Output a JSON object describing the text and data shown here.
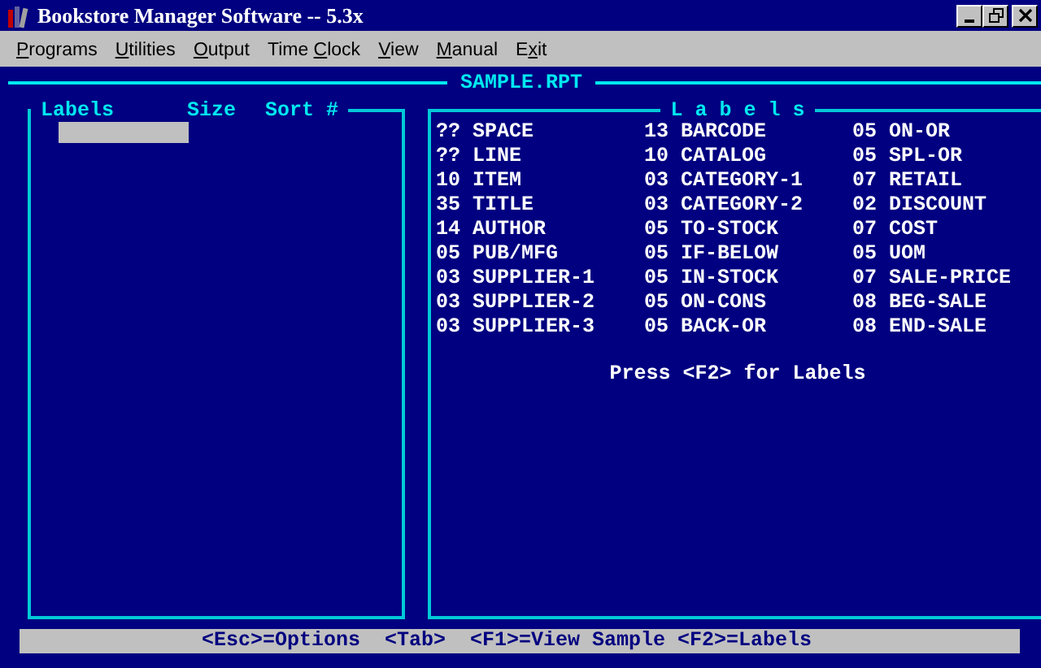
{
  "window": {
    "title": "Bookstore Manager Software -- 5.3x"
  },
  "menu": [
    {
      "key": "P",
      "post": "rograms"
    },
    {
      "key": "U",
      "post": "tilities"
    },
    {
      "key": "O",
      "post": "utput"
    },
    {
      "pre": "Time ",
      "key": "C",
      "post": "lock"
    },
    {
      "key": "V",
      "post": "iew"
    },
    {
      "key": "M",
      "post": "anual"
    },
    {
      "pre": "E",
      "key": "x",
      "post": "it"
    }
  ],
  "report_title": "SAMPLE.RPT",
  "left_panel": {
    "headers": [
      "Labels",
      "Size",
      "Sort #"
    ]
  },
  "right_panel": {
    "title": "L a b e l s",
    "hint": "Press <F2> for Labels",
    "labels": [
      {
        "size": "??",
        "name": "SPACE"
      },
      {
        "size": "??",
        "name": "LINE"
      },
      {
        "size": "10",
        "name": "ITEM"
      },
      {
        "size": "35",
        "name": "TITLE"
      },
      {
        "size": "14",
        "name": "AUTHOR"
      },
      {
        "size": "05",
        "name": "PUB/MFG"
      },
      {
        "size": "03",
        "name": "SUPPLIER-1"
      },
      {
        "size": "03",
        "name": "SUPPLIER-2"
      },
      {
        "size": "03",
        "name": "SUPPLIER-3"
      },
      {
        "size": "13",
        "name": "BARCODE"
      },
      {
        "size": "10",
        "name": "CATALOG"
      },
      {
        "size": "03",
        "name": "CATEGORY-1"
      },
      {
        "size": "03",
        "name": "CATEGORY-2"
      },
      {
        "size": "05",
        "name": "TO-STOCK"
      },
      {
        "size": "05",
        "name": "IF-BELOW"
      },
      {
        "size": "05",
        "name": "IN-STOCK"
      },
      {
        "size": "05",
        "name": "ON-CONS"
      },
      {
        "size": "05",
        "name": "BACK-OR"
      },
      {
        "size": "05",
        "name": "ON-OR"
      },
      {
        "size": "05",
        "name": "SPL-OR"
      },
      {
        "size": "07",
        "name": "RETAIL"
      },
      {
        "size": "02",
        "name": "DISCOUNT"
      },
      {
        "size": "07",
        "name": "COST"
      },
      {
        "size": "05",
        "name": "UOM"
      },
      {
        "size": "07",
        "name": "SALE-PRICE"
      },
      {
        "size": "08",
        "name": "BEG-SALE"
      },
      {
        "size": "08",
        "name": "END-SALE"
      }
    ]
  },
  "status_bar": "<Esc>=Options  <Tab>  <F1>=View Sample <F2>=Labels"
}
